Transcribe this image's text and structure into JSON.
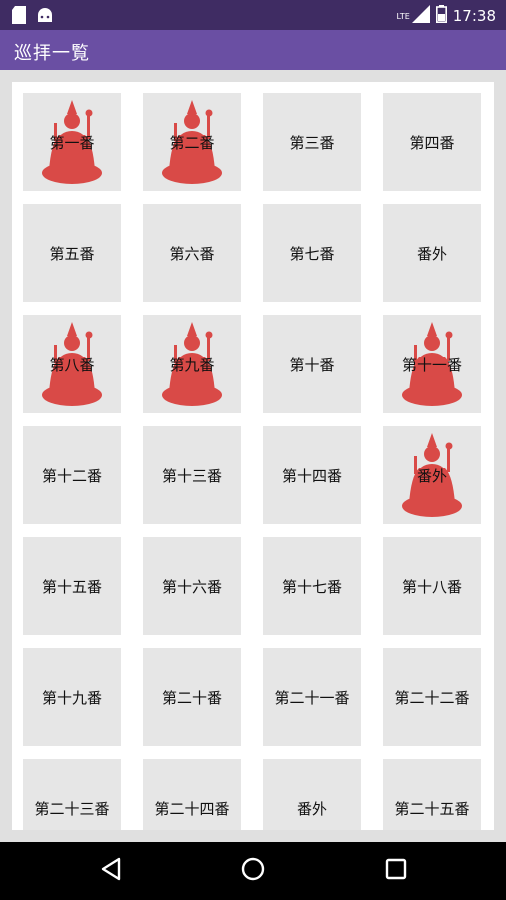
{
  "status": {
    "time": "17:38",
    "network": "LTE"
  },
  "appbar": {
    "title": "巡拝一覧"
  },
  "colors": {
    "statusbar": "#3f2c63",
    "appbar": "#6a4fa3",
    "statue": "#d94a47",
    "tile": "#e6e6e6"
  },
  "items": [
    {
      "label": "第一番",
      "statue": true
    },
    {
      "label": "第二番",
      "statue": true
    },
    {
      "label": "第三番",
      "statue": false
    },
    {
      "label": "第四番",
      "statue": false
    },
    {
      "label": "第五番",
      "statue": false
    },
    {
      "label": "第六番",
      "statue": false
    },
    {
      "label": "第七番",
      "statue": false
    },
    {
      "label": "番外",
      "statue": false
    },
    {
      "label": "第八番",
      "statue": true
    },
    {
      "label": "第九番",
      "statue": true
    },
    {
      "label": "第十番",
      "statue": false
    },
    {
      "label": "第十一番",
      "statue": true
    },
    {
      "label": "第十二番",
      "statue": false
    },
    {
      "label": "第十三番",
      "statue": false
    },
    {
      "label": "第十四番",
      "statue": false
    },
    {
      "label": "番外",
      "statue": true
    },
    {
      "label": "第十五番",
      "statue": false
    },
    {
      "label": "第十六番",
      "statue": false
    },
    {
      "label": "第十七番",
      "statue": false
    },
    {
      "label": "第十八番",
      "statue": false
    },
    {
      "label": "第十九番",
      "statue": false
    },
    {
      "label": "第二十番",
      "statue": false
    },
    {
      "label": "第二十一番",
      "statue": false
    },
    {
      "label": "第二十二番",
      "statue": false
    },
    {
      "label": "第二十三番",
      "statue": false
    },
    {
      "label": "第二十四番",
      "statue": false
    },
    {
      "label": "番外",
      "statue": false
    },
    {
      "label": "第二十五番",
      "statue": false
    }
  ],
  "navbar": {
    "back": "back-icon",
    "home": "home-icon",
    "recents": "recents-icon"
  }
}
